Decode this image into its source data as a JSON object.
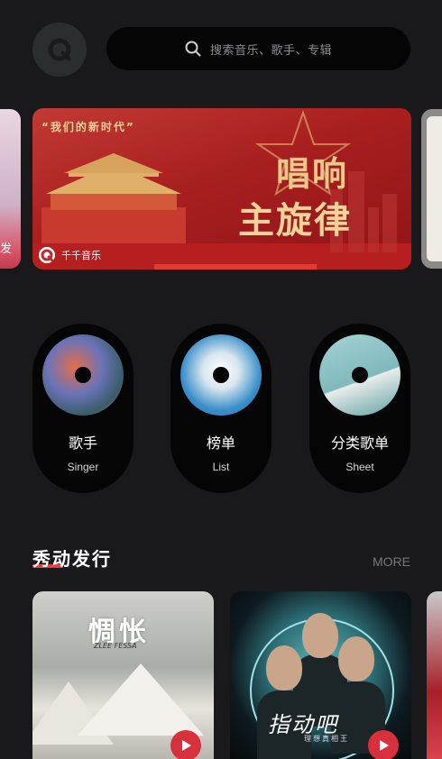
{
  "header": {
    "logo": "qianqian-logo-icon",
    "search": {
      "placeholder": "搜索音乐、歌手、专辑",
      "icon": "search-icon"
    }
  },
  "banner": {
    "slogan": "“我们的新时代”",
    "headline_1": "唱响",
    "headline_2": "主旋律",
    "brand": "千千音乐",
    "left_peek_text": "发"
  },
  "categories": [
    {
      "title": "歌手",
      "subtitle": "Singer"
    },
    {
      "title": "榜单",
      "subtitle": "List"
    },
    {
      "title": "分类歌单",
      "subtitle": "Sheet"
    }
  ],
  "section": {
    "title": "秀动发行",
    "more": "MORE"
  },
  "albums": [
    {
      "title": "惆怅",
      "subtitle": "ZLEE FESSA"
    },
    {
      "title": "指动吧",
      "subtitle": "理想真相王"
    }
  ],
  "colors": {
    "background": "#19191b",
    "accent": "#d8303c",
    "surface": "#050506"
  }
}
